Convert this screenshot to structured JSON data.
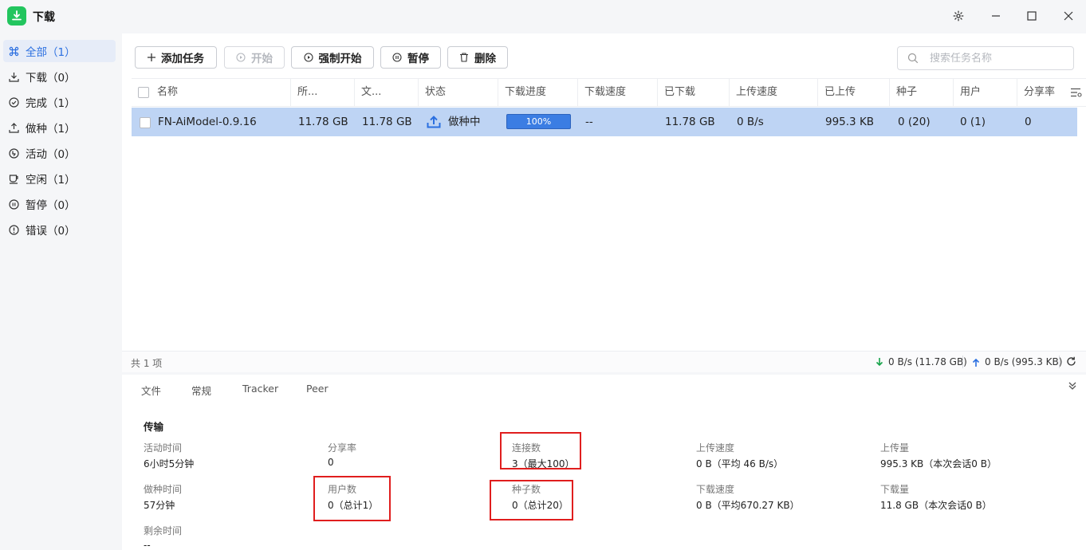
{
  "app": {
    "title": "下载"
  },
  "sidebar": {
    "items": [
      {
        "label": "全部（1）",
        "icon": "grid-icon"
      },
      {
        "label": "下载（0）",
        "icon": "download-icon"
      },
      {
        "label": "完成（1）",
        "icon": "check-circle-icon"
      },
      {
        "label": "做种（1）",
        "icon": "upload-icon"
      },
      {
        "label": "活动（0）",
        "icon": "activity-icon"
      },
      {
        "label": "空闲（1）",
        "icon": "cup-icon"
      },
      {
        "label": "暂停（0）",
        "icon": "pause-circle-icon"
      },
      {
        "label": "错误（0）",
        "icon": "alert-circle-icon"
      }
    ]
  },
  "toolbar": {
    "add_label": "添加任务",
    "start_label": "开始",
    "force_start_label": "强制开始",
    "pause_label": "暂停",
    "delete_label": "删除"
  },
  "search": {
    "placeholder": "搜索任务名称"
  },
  "table": {
    "columns": [
      "名称",
      "所...",
      "文...",
      "状态",
      "下载进度",
      "下载速度",
      "已下载",
      "上传速度",
      "已上传",
      "种子",
      "用户",
      "分享率"
    ],
    "rows": [
      {
        "name": "FN-AiModel-0.9.16",
        "size": "11.78 GB",
        "file_size": "11.78 GB",
        "status": "做种中",
        "progress_label": "100%",
        "progress_pct": 100,
        "down_speed": "--",
        "downloaded": "11.78 GB",
        "up_speed": "0 B/s",
        "uploaded": "995.3 KB",
        "seeds": "0 (20)",
        "peers": "0 (1)",
        "ratio": "0"
      }
    ]
  },
  "footer": {
    "count": "共 1 项",
    "down": "0 B/s (11.78 GB)",
    "up": "0 B/s (995.3 KB)"
  },
  "details": {
    "tabs": [
      "文件",
      "常规",
      "Tracker",
      "Peer"
    ],
    "section": "传输",
    "fields": {
      "active_time": {
        "label": "活动时间",
        "value": "6小时5分钟"
      },
      "share_ratio": {
        "label": "分享率",
        "value": "0"
      },
      "connections": {
        "label": "连接数",
        "value": "3（最大100）"
      },
      "up_speed": {
        "label": "上传速度",
        "value": "0 B（平均 46 B/s）"
      },
      "uploaded": {
        "label": "上传量",
        "value": "995.3 KB（本次会话0 B）"
      },
      "seed_time": {
        "label": "做种时间",
        "value": "57分钟"
      },
      "peers": {
        "label": "用户数",
        "value": "0（总计1）"
      },
      "seeds": {
        "label": "种子数",
        "value": "0（总计20）"
      },
      "down_speed": {
        "label": "下载速度",
        "value": "0 B（平均670.27 KB）"
      },
      "downloaded": {
        "label": "下载量",
        "value": "11.8 GB（本次会话0 B）"
      },
      "remaining": {
        "label": "剩余时间",
        "value": "--"
      }
    }
  },
  "colors": {
    "accent": "#2b6fe0",
    "app_icon": "#22c55e",
    "row_selected": "#bed4f4",
    "progress": "#3b7de3",
    "highlight": "#e01e1e"
  }
}
